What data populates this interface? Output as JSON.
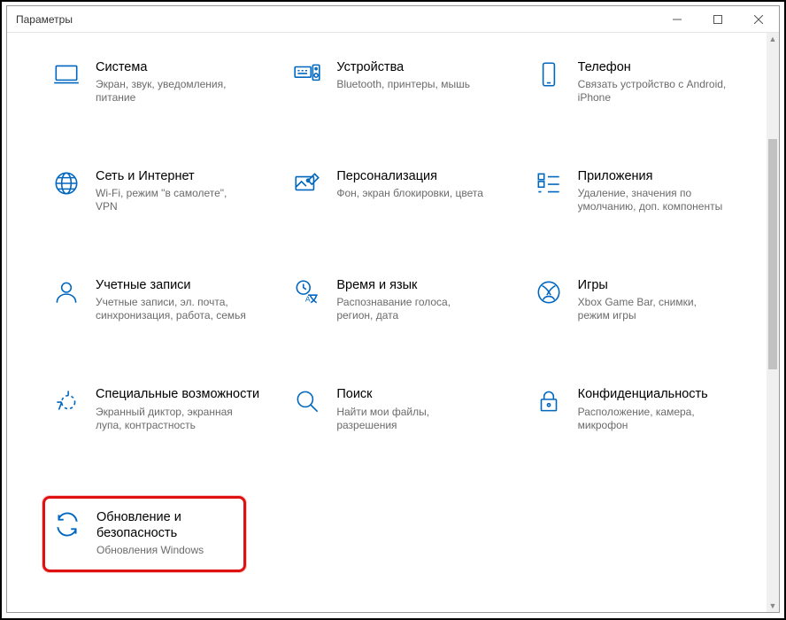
{
  "window": {
    "title": "Параметры"
  },
  "tiles": {
    "system": {
      "title": "Система",
      "desc": "Экран, звук, уведомления, питание"
    },
    "devices": {
      "title": "Устройства",
      "desc": "Bluetooth, принтеры, мышь"
    },
    "phone": {
      "title": "Телефон",
      "desc": "Связать устройство с Android, iPhone"
    },
    "network": {
      "title": "Сеть и Интернет",
      "desc": "Wi-Fi, режим \"в самолете\", VPN"
    },
    "personal": {
      "title": "Персонализация",
      "desc": "Фон, экран блокировки, цвета"
    },
    "apps": {
      "title": "Приложения",
      "desc": "Удаление, значения по умолчанию, доп. компоненты"
    },
    "accounts": {
      "title": "Учетные записи",
      "desc": "Учетные записи, эл. почта, синхронизация, работа, семья"
    },
    "time": {
      "title": "Время и язык",
      "desc": "Распознавание голоса, регион, дата"
    },
    "gaming": {
      "title": "Игры",
      "desc": "Xbox Game Bar, снимки, режим игры"
    },
    "access": {
      "title": "Специальные возможности",
      "desc": "Экранный диктор, экранная лупа, контрастность"
    },
    "search": {
      "title": "Поиск",
      "desc": "Найти мои файлы, разрешения"
    },
    "privacy": {
      "title": "Конфиденциальность",
      "desc": "Расположение, камера, микрофон"
    },
    "update": {
      "title": "Обновление и безопасность",
      "desc": "Обновления Windows"
    }
  },
  "colors": {
    "accent": "#0067c0",
    "highlight": "#de1010"
  }
}
